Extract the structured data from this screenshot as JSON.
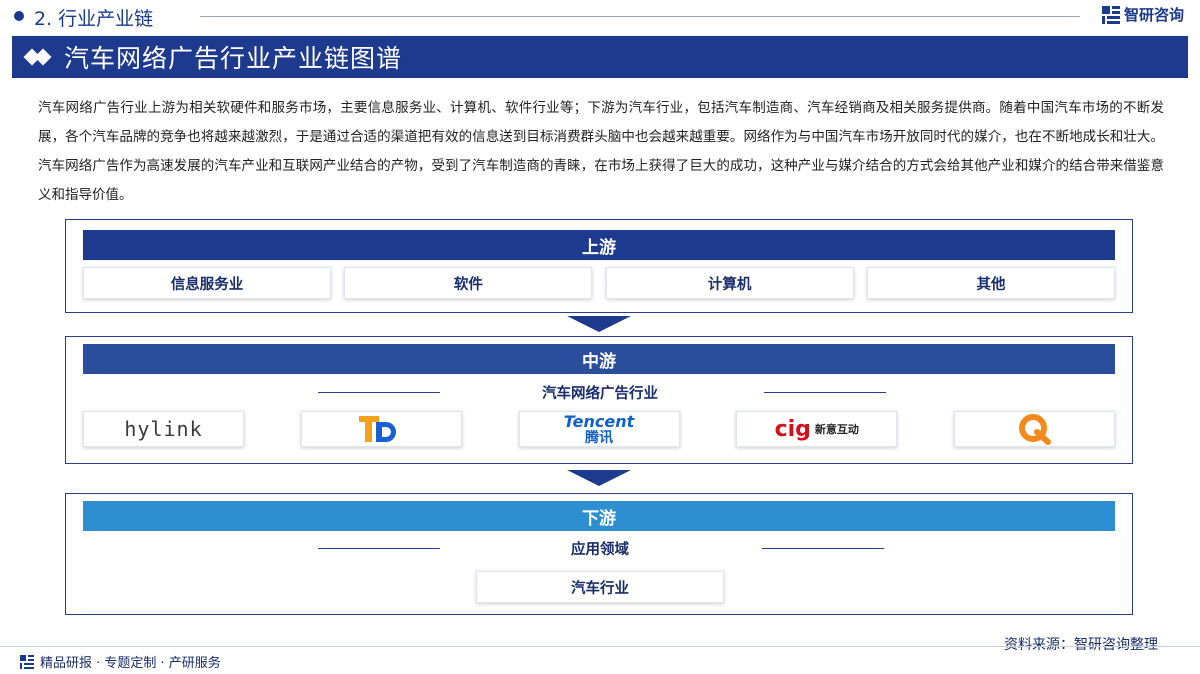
{
  "header": {
    "section_number": "2. 行业产业链",
    "brand_name": "智研咨询"
  },
  "title": "汽车网络广告行业产业链图谱",
  "intro": "汽车网络广告行业上游为相关软硬件和服务市场，主要信息服务业、计算机、软件行业等；下游为汽车行业，包括汽车制造商、汽车经销商及相关服务提供商。随着中国汽车市场的不断发展，各个汽车品牌的竞争也将越来越激烈，于是通过合适的渠道把有效的信息送到目标消费群头脑中也会越来越重要。网络作为与中国汽车市场开放同时代的媒介，也在不断地成长和壮大。汽车网络广告作为高速发展的汽车产业和互联网产业结合的产物，受到了汽车制造商的青睐，在市场上获得了巨大的成功，这种产业与媒介结合的方式会给其他产业和媒介的结合带来借鉴意义和指导价值。",
  "upstream": {
    "label": "上游",
    "items": [
      "信息服务业",
      "软件",
      "计算机",
      "其他"
    ]
  },
  "midstream": {
    "label": "中游",
    "sublabel": "汽车网络广告行业",
    "logos": [
      {
        "name": "hylink",
        "text": "hylink"
      },
      {
        "name": "td-logo",
        "text": ""
      },
      {
        "name": "tencent",
        "text_en": "Tencent",
        "text_cn": "腾讯"
      },
      {
        "name": "cig",
        "text_en": "cig",
        "text_cn": "新意互动"
      },
      {
        "name": "q-logo",
        "text": ""
      }
    ]
  },
  "downstream": {
    "label": "下游",
    "sublabel": "应用领域",
    "item": "汽车行业"
  },
  "source": "资料来源：智研咨询整理",
  "footer": "精品研报 · 专题定制 · 产研服务",
  "colors": {
    "navy": "#1e3a8f",
    "mid_blue": "#2a4d9c",
    "light_blue": "#2e8fd0",
    "orange": "#f5a21b",
    "red": "#d4111a"
  }
}
